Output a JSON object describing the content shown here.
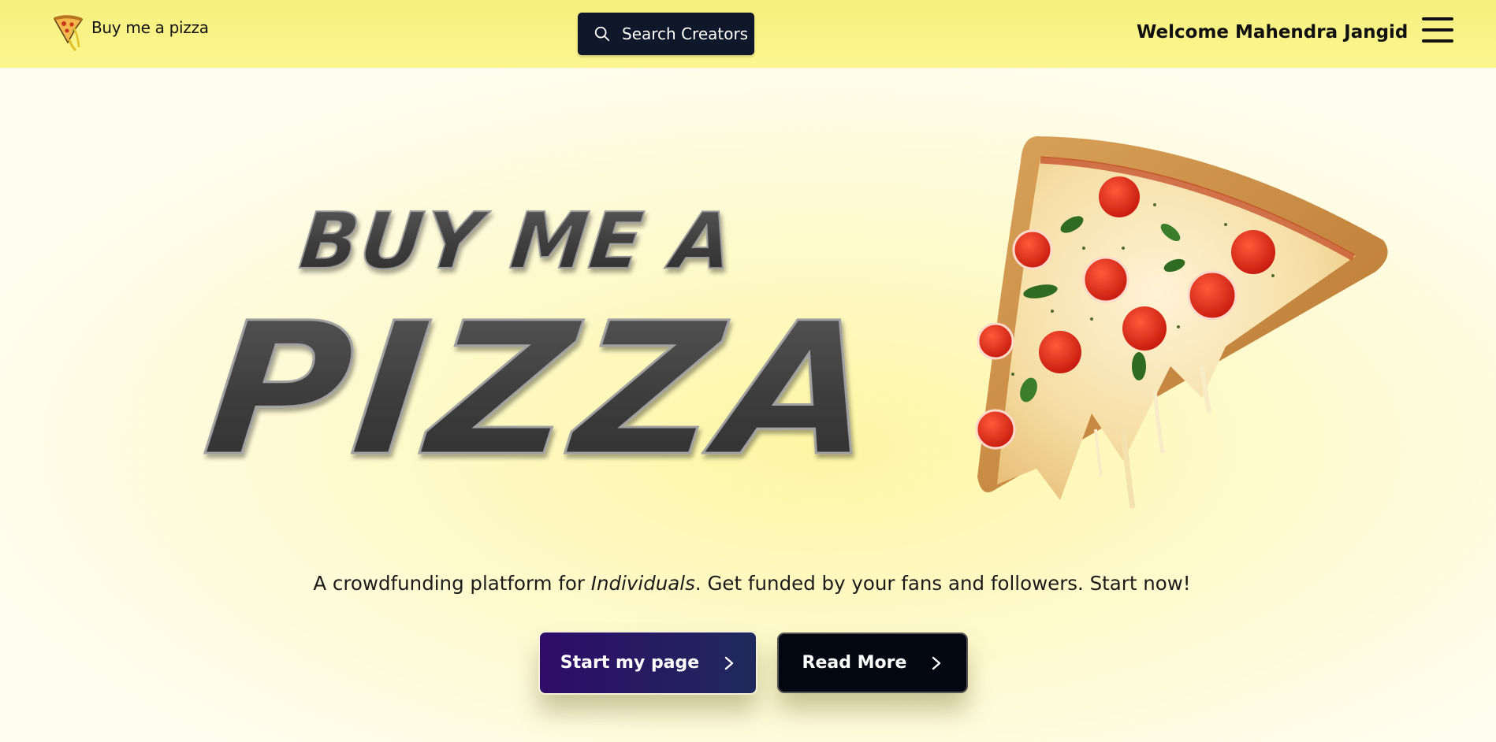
{
  "nav": {
    "logo_text": "Buy me a pizza",
    "search_label": "Search Creators",
    "welcome_text": "Welcome Mahendra Jangid"
  },
  "hero": {
    "title_line1": "BUY ME A",
    "title_line2": "PIZZA",
    "tagline_before": "A crowdfunding platform for ",
    "tagline_emphasis": "Individuals",
    "tagline_after": ". Get funded by your fans and followers. Start now!",
    "primary_button": "Start my page",
    "secondary_button": "Read More"
  },
  "colors": {
    "nav_bg": "#fdf68f",
    "primary_button": "#2e0c68",
    "secondary_button": "#030712",
    "search_button": "#0f172a"
  },
  "icons": [
    "pizza-logo-icon",
    "search-icon",
    "hamburger-menu-icon",
    "chevron-right-icon"
  ]
}
